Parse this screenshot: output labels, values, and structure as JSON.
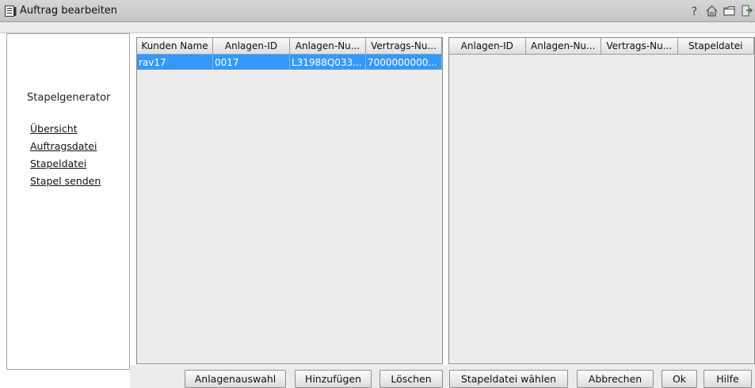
{
  "window": {
    "title": "Auftrag bearbeiten"
  },
  "toolbar_icons": [
    "help-icon",
    "home-icon",
    "folder-icon",
    "exit-icon"
  ],
  "sidebar": {
    "title": "Stapelgenerator",
    "links": [
      "Übersicht",
      "Auftragsdatei",
      "Stapeldatei",
      "Stapel senden"
    ]
  },
  "left_table": {
    "columns": [
      "Kunden Name",
      "Anlagen-ID",
      "Anlagen-Nu...",
      "Vertrags-Nu..."
    ],
    "rows": [
      {
        "cells": [
          "rav17",
          "0017",
          "L31988Q033...",
          "7000000000..."
        ],
        "selected": true
      }
    ]
  },
  "right_table": {
    "columns": [
      "Anlagen-ID",
      "Anlagen-Nu...",
      "Vertrags-Nu...",
      "Stapeldatei"
    ],
    "rows": []
  },
  "buttons": {
    "anlagenauswahl": "Anlagenauswahl",
    "hinzufuegen": "Hinzufügen",
    "loeschen": "Löschen",
    "stapeldatei_waehlen": "Stapeldatei wählen",
    "abbrechen": "Abbrechen",
    "ok": "Ok",
    "hilfe": "Hilfe"
  },
  "colors": {
    "selection": "#3399ff",
    "panel_bg": "#ececec",
    "titlebar": "#c8c8c8"
  }
}
